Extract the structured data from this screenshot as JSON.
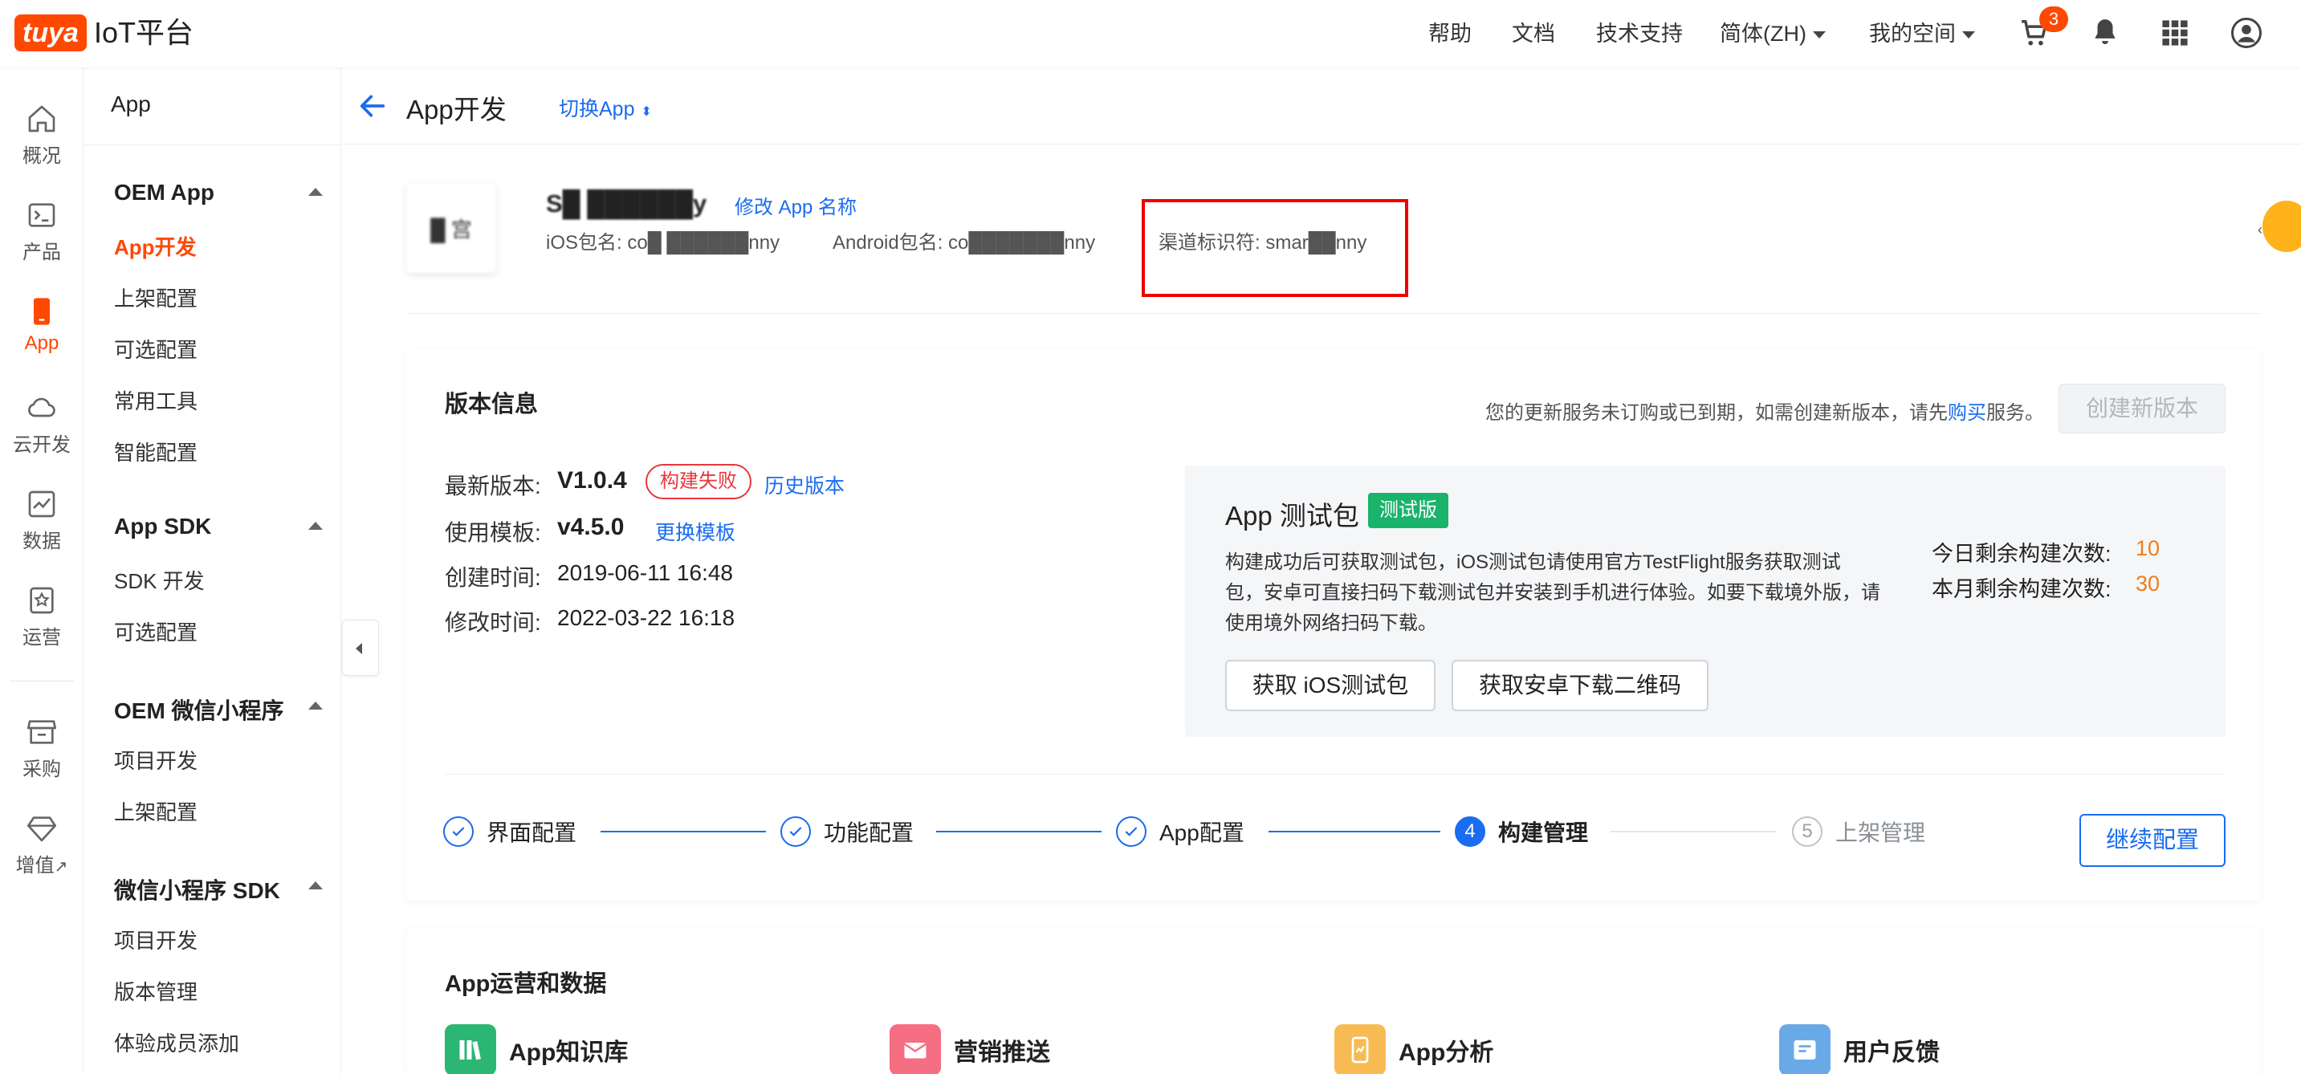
{
  "header": {
    "logo": "tuya",
    "brand": "IoT平台",
    "nav": [
      "帮助",
      "文档",
      "技术支持"
    ],
    "lang": "简体(ZH)",
    "space": "我的空间",
    "cart_count": "3",
    "icons": [
      "cart-icon",
      "bell-icon",
      "apps-grid-icon",
      "user-avatar-icon"
    ]
  },
  "rail": {
    "items": [
      {
        "label": "概况",
        "icon": "home-icon"
      },
      {
        "label": "产品",
        "icon": "terminal-icon"
      },
      {
        "label": "App",
        "icon": "phone-icon"
      },
      {
        "label": "云开发",
        "icon": "cloud-icon"
      },
      {
        "label": "数据",
        "icon": "chart-icon"
      },
      {
        "label": "运营",
        "icon": "star-badge-icon"
      },
      {
        "label": "采购",
        "icon": "shop-icon"
      },
      {
        "label": "增值",
        "icon": "diamond-icon",
        "suffix": "↗"
      }
    ]
  },
  "sidebar": {
    "title": "App",
    "groups": [
      {
        "title": "OEM App",
        "items": [
          "App开发",
          "上架配置",
          "可选配置",
          "常用工具",
          "智能配置"
        ]
      },
      {
        "title": "App SDK",
        "items": [
          "SDK 开发",
          "可选配置"
        ]
      },
      {
        "title": "OEM 微信小程序",
        "items": [
          "项目开发",
          "上架配置"
        ]
      },
      {
        "title": "微信小程序 SDK",
        "items": [
          "项目开发",
          "版本管理",
          "体验成员添加"
        ]
      }
    ]
  },
  "page": {
    "back": "←",
    "title": "App开发",
    "switch": "切换App"
  },
  "app_info": {
    "name": "S█ ██████y",
    "rename": "修改 App 名称",
    "ios_pkg": "iOS包名: co█ ██████nny",
    "android_pkg": "Android包名: co███████nny",
    "channel": "渠道标识符: smar██nny",
    "icon_text": "█ 宫"
  },
  "version": {
    "title": "版本信息",
    "notice_pre": "您的更新服务未订购或已到期，如需创建新版本，请先",
    "notice_link": "购买",
    "notice_post": "服务。",
    "create_btn": "创建新版本",
    "latest_label": "最新版本:",
    "latest_value": "V1.0.4",
    "build_status": "构建失败",
    "history": "历史版本",
    "template_label": "使用模板:",
    "template_value": "v4.5.0",
    "change_template": "更换模板",
    "created_label": "创建时间:",
    "created_value": "2019-06-11 16:48",
    "modified_label": "修改时间:",
    "modified_value": "2022-03-22 16:18"
  },
  "test_pkg": {
    "title": "App 测试包",
    "tag": "测试版",
    "desc_1": "构建成功后可获取测试包，iOS测试包请使用官方TestFlight服务获取测试",
    "desc_2": "包，安卓可直接扫码下载测试包并安装到手机进行体验。如要下载境外版，请",
    "desc_3": "使用境外网络扫码下载。",
    "ios_btn": "获取 iOS测试包",
    "android_btn": "获取安卓下载二维码",
    "today_label": "今日剩余构建次数:",
    "today_value": "10",
    "month_label": "本月剩余构建次数:",
    "month_value": "30"
  },
  "steps": [
    {
      "label": "界面配置",
      "state": "done"
    },
    {
      "label": "功能配置",
      "state": "done"
    },
    {
      "label": "App配置",
      "state": "done"
    },
    {
      "label": "构建管理",
      "state": "current",
      "num": "4"
    },
    {
      "label": "上架管理",
      "state": "todo",
      "num": "5"
    }
  ],
  "continue_btn": "继续配置",
  "ops": {
    "title": "App运营和数据",
    "tiles": [
      {
        "label": "App知识库",
        "icon": "books-icon",
        "color": "#2cb673"
      },
      {
        "label": "营销推送",
        "icon": "mail-icon",
        "color": "#f56e82"
      },
      {
        "label": "App分析",
        "icon": "phone-analytics-icon",
        "color": "#f8bb54"
      },
      {
        "label": "用户反馈",
        "icon": "feedback-icon",
        "color": "#6aa9e8"
      }
    ]
  },
  "colors": {
    "brand": "#ff4800",
    "link": "#1a6cf0",
    "success": "#19b36b",
    "error": "#e8373a",
    "warning": "#f07d1a"
  }
}
